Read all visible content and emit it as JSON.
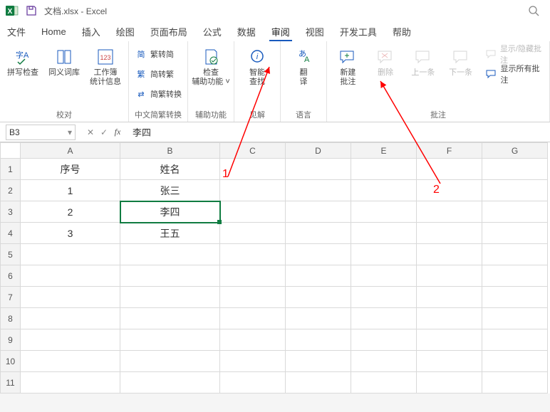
{
  "title": {
    "filename": "文档.xlsx",
    "sep": " - ",
    "app": "Excel"
  },
  "menu": {
    "file": "文件",
    "home": "Home",
    "insert": "插入",
    "draw": "绘图",
    "layout": "页面布局",
    "formula": "公式",
    "data": "数据",
    "review": "审阅",
    "view": "视图",
    "dev": "开发工具",
    "help": "帮助"
  },
  "ribbon": {
    "proofing": {
      "label": "校对",
      "spell": "拼写检查",
      "thesaurus": "同义词库",
      "stats": "工作簿\n统计信息"
    },
    "cjk": {
      "label": "中文简繁转换",
      "s2t": "繁转简",
      "t2s": "简转繁",
      "conv": "简繁转换"
    },
    "acc": {
      "label": "辅助功能",
      "check": "检查\n辅助功能 ˅"
    },
    "insight": {
      "label": "见解",
      "smart": "智能\n查找"
    },
    "lang": {
      "label": "语言",
      "trans": "翻\n译"
    },
    "comments": {
      "label": "批注",
      "new": "新建\n批注",
      "del": "删除",
      "prev": "上一条",
      "next": "下一条",
      "show1": "显示/隐藏批注",
      "show2": "显示所有批注"
    }
  },
  "namebox": "B3",
  "formula": "李四",
  "cols": [
    "A",
    "B",
    "C",
    "D",
    "E",
    "F",
    "G"
  ],
  "rows": [
    "1",
    "2",
    "3",
    "4",
    "5",
    "6",
    "7",
    "8",
    "9",
    "10",
    "11"
  ],
  "cells": {
    "A1": "序号",
    "B1": "姓名",
    "A2": "1",
    "B2": "张三",
    "A3": "2",
    "B3": "李四",
    "A4": "3",
    "B4": "王五"
  },
  "annot": {
    "a1": "1",
    "a2": "2"
  },
  "selected": "B3"
}
